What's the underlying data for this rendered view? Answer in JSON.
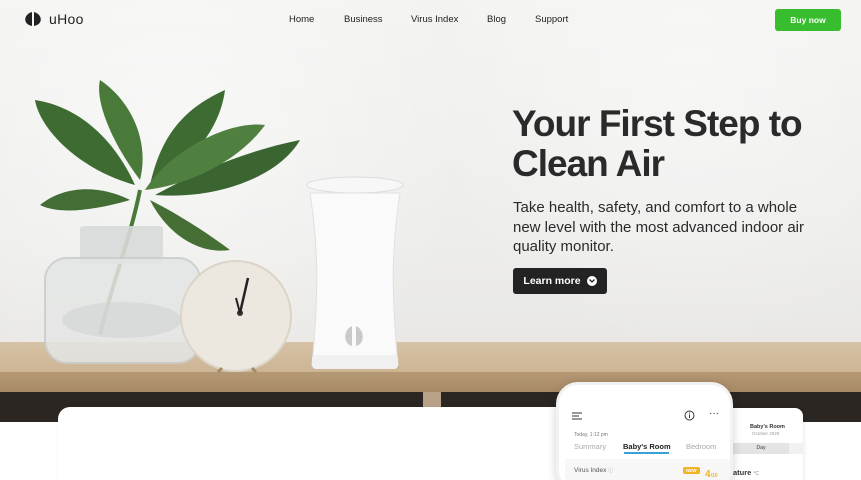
{
  "brand": {
    "name": "uHoo"
  },
  "nav": {
    "links": [
      "Home",
      "Business",
      "Virus Index",
      "Blog",
      "Support"
    ],
    "cta": "Buy now"
  },
  "hero": {
    "headline_line1": "Your First Step to",
    "headline_line2": "Clean Air",
    "subtext": "Take health, safety, and comfort to a whole new level with the most advanced indoor air quality monitor.",
    "button": "Learn more"
  },
  "phone": {
    "timestamp": "Today, 1:12 pm",
    "tabs": [
      "Summary",
      "Baby's Room",
      "Bedroom"
    ],
    "active_tab": "Baby's Room",
    "metric_label": "Virus Index",
    "badge": "NEW",
    "metric_value": "4",
    "metric_unit": "/10"
  },
  "tablet": {
    "room": "Baby's Room",
    "date": "October 2020",
    "range_tab": "Day",
    "metric_partial": "ature",
    "metric_unit": "°C"
  },
  "colors": {
    "accent_green": "#37bd2e",
    "dark_button": "#232323",
    "tab_underline": "#3aa0d8",
    "badge_yellow": "#f0b429"
  }
}
